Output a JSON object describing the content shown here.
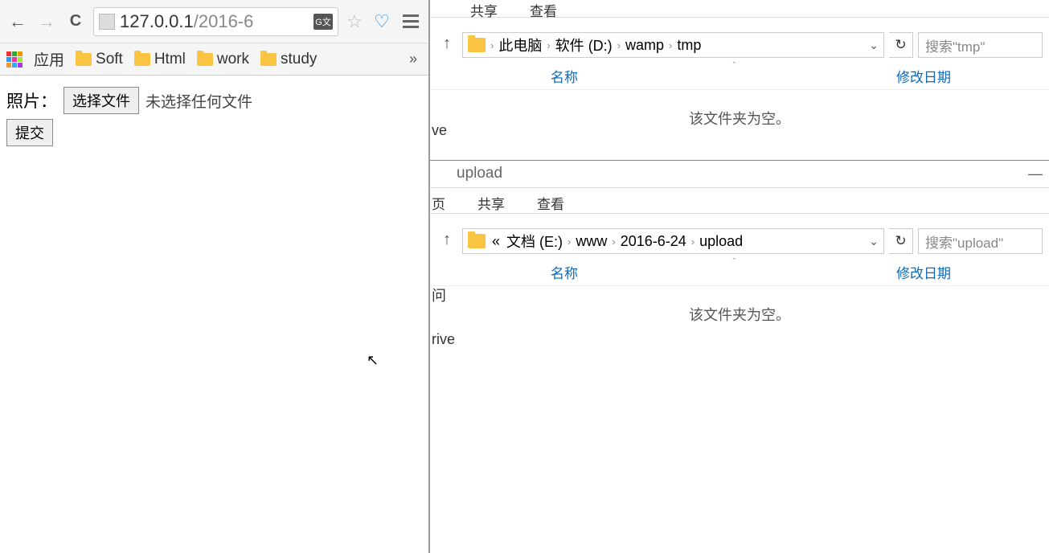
{
  "browser": {
    "url_host": "127.0.0.1",
    "url_path": "/2016-6",
    "translate_badge": "G文",
    "bookmarks": {
      "apps_label": "应用",
      "items": [
        "Soft",
        "Html",
        "work",
        "study"
      ],
      "more": "»"
    },
    "page": {
      "label": "照片：",
      "choose_file": "选择文件",
      "no_file": "未选择任何文件",
      "submit": "提交"
    }
  },
  "explorer_top": {
    "ribbon": [
      "共享",
      "查看"
    ],
    "breadcrumb": [
      "此电脑",
      "软件 (D:)",
      "wamp",
      "tmp"
    ],
    "search_placeholder": "搜索\"tmp\"",
    "columns": {
      "name": "名称",
      "date": "修改日期"
    },
    "empty": "该文件夹为空。",
    "side_text": "ve"
  },
  "explorer_bottom": {
    "title": "upload",
    "ribbon": [
      "页",
      "共享",
      "查看"
    ],
    "breadcrumb_prefix": "«",
    "breadcrumb": [
      "文档 (E:)",
      "www",
      "2016-6-24",
      "upload"
    ],
    "search_placeholder": "搜索\"upload\"",
    "columns": {
      "name": "名称",
      "date": "修改日期"
    },
    "empty": "该文件夹为空。",
    "side_texts": [
      "问",
      "rive"
    ]
  }
}
